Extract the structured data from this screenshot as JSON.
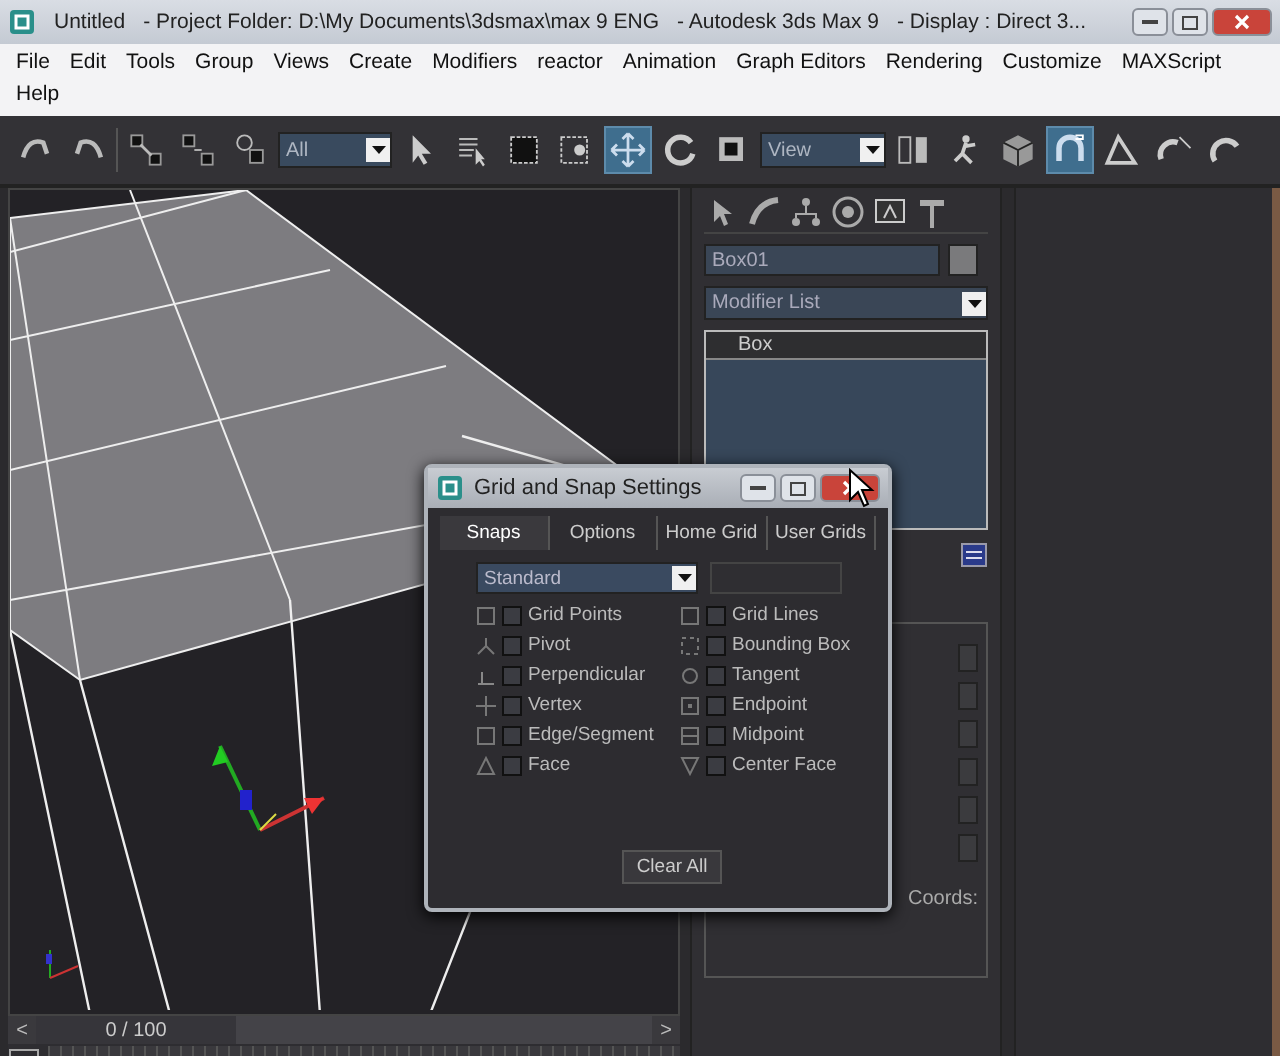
{
  "window": {
    "title_parts": [
      "Untitled",
      "- Project Folder: D:\\My Documents\\3dsmax\\max 9 ENG",
      "- Autodesk 3ds Max 9",
      "- Display : Direct 3..."
    ]
  },
  "menu": [
    "File",
    "Edit",
    "Tools",
    "Group",
    "Views",
    "Create",
    "Modifiers",
    "reactor",
    "Animation",
    "Graph Editors",
    "Rendering",
    "Customize",
    "MAXScript",
    "Help"
  ],
  "toolbar": [
    {
      "kind": "icon",
      "on": false
    },
    {
      "kind": "icon",
      "on": false
    },
    {
      "kind": "sep"
    },
    {
      "kind": "icon",
      "on": false
    },
    {
      "kind": "icon",
      "on": false
    },
    {
      "kind": "icon",
      "on": false
    },
    {
      "kind": "dropdown",
      "value": "All"
    },
    {
      "kind": "icon",
      "on": false
    },
    {
      "kind": "icon",
      "on": false
    },
    {
      "kind": "icon",
      "on": false
    },
    {
      "kind": "icon",
      "on": false
    },
    {
      "kind": "icon",
      "on": true
    },
    {
      "kind": "icon",
      "on": false
    },
    {
      "kind": "icon",
      "on": false
    },
    {
      "kind": "dropdown",
      "value": "View"
    },
    {
      "kind": "icon",
      "on": false
    },
    {
      "kind": "icon",
      "on": false
    },
    {
      "kind": "icon",
      "on": false
    },
    {
      "kind": "icon",
      "on": true
    },
    {
      "kind": "icon",
      "on": false
    },
    {
      "kind": "icon",
      "on": false
    },
    {
      "kind": "icon",
      "on": false
    }
  ],
  "timeline": {
    "frame": "0 / 100",
    "prev": "<",
    "next": ">",
    "level": 0
  },
  "command_panel": {
    "object_name": "Box01",
    "modifier_list": "Modifier List",
    "stack": [
      {
        "label": "Box",
        "selected": true
      }
    ],
    "rollout_text": "Coords:"
  },
  "dialog": {
    "title": "Grid and Snap Settings",
    "tabs": [
      {
        "label": "Snaps",
        "selected": true
      },
      {
        "label": "Options",
        "selected": false
      },
      {
        "label": "Home Grid",
        "selected": false
      },
      {
        "label": "User Grids",
        "selected": false
      }
    ],
    "preset": "Standard",
    "snaps": [
      {
        "label": "Grid Points",
        "checked": false
      },
      {
        "label": "Grid Lines",
        "checked": false
      },
      {
        "label": "Pivot",
        "checked": false
      },
      {
        "label": "Bounding Box",
        "checked": false
      },
      {
        "label": "Perpendicular",
        "checked": false
      },
      {
        "label": "Tangent",
        "checked": false
      },
      {
        "label": "Vertex",
        "checked": false
      },
      {
        "label": "Endpoint",
        "checked": false
      },
      {
        "label": "Edge/Segment",
        "checked": false
      },
      {
        "label": "Midpoint",
        "checked": false
      },
      {
        "label": "Face",
        "checked": false
      },
      {
        "label": "Center Face",
        "checked": false
      }
    ],
    "clear_button": "Clear All"
  }
}
